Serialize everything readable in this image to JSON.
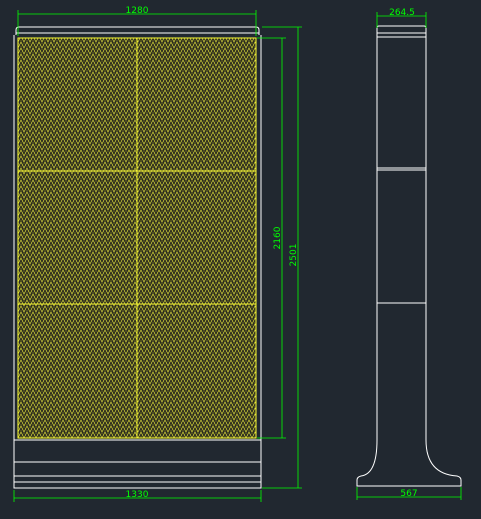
{
  "colors": {
    "background": "#212830",
    "outline": "#ffffff",
    "panel": "#ffff33",
    "dimension": "#00ff00"
  },
  "front_view": {
    "dimensions": {
      "top_width": "1280",
      "bottom_width": "1330",
      "panel_height": "2160",
      "total_height": "2501"
    }
  },
  "side_view": {
    "dimensions": {
      "top_depth": "264.5",
      "base_depth": "567"
    }
  }
}
